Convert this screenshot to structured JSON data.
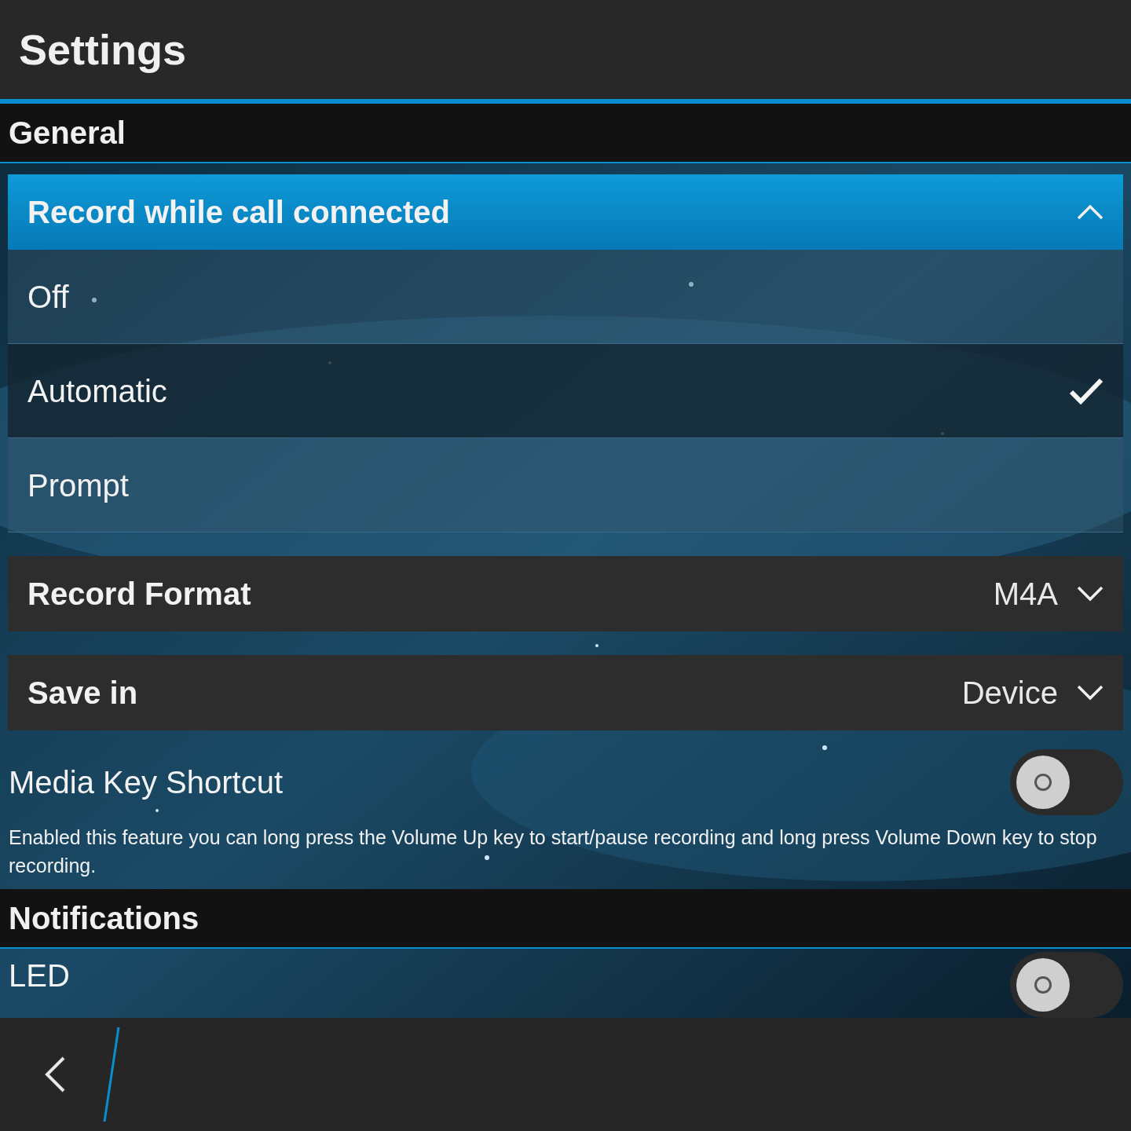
{
  "title": "Settings",
  "sections": [
    {
      "title": "General",
      "items": [
        {
          "kind": "dropdown",
          "label": "Record while call connected",
          "expanded": true,
          "options": [
            {
              "label": "Off",
              "selected": false
            },
            {
              "label": "Automatic",
              "selected": true
            },
            {
              "label": "Prompt",
              "selected": false
            }
          ]
        },
        {
          "kind": "dropdown",
          "label": "Record Format",
          "value": "M4A",
          "expanded": false
        },
        {
          "kind": "dropdown",
          "label": "Save in",
          "value": "Device",
          "expanded": false
        },
        {
          "kind": "toggle",
          "label": "Media Key Shortcut",
          "on": false,
          "description": "Enabled this feature you can long press the Volume Up key to start/pause recording and long press Volume Down key to stop recording."
        }
      ]
    },
    {
      "title": "Notifications",
      "items": [
        {
          "kind": "toggle",
          "label": "LED",
          "on": false
        }
      ]
    }
  ]
}
